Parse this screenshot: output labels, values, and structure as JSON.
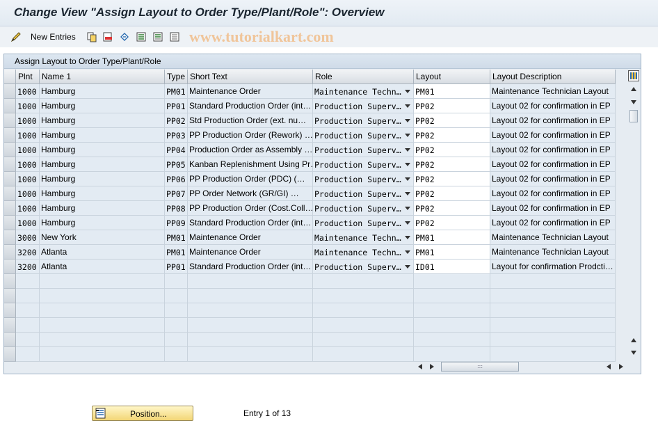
{
  "window": {
    "title": "Change View \"Assign Layout to Order Type/Plant/Role\": Overview"
  },
  "toolbar": {
    "new_entries_label": "New Entries",
    "icons": [
      "pencil-glasses-icon",
      "copy-icon",
      "delete-icon",
      "undo-icon",
      "select-all-icon",
      "select-block-icon",
      "deselect-all-icon"
    ]
  },
  "watermark": "www.tutorialkart.com",
  "panel": {
    "title": "Assign Layout to Order Type/Plant/Role"
  },
  "table": {
    "columns": [
      "Plnt",
      "Name 1",
      "Type",
      "Short Text",
      "Role",
      "Layout",
      "Layout Description"
    ],
    "rows": [
      [
        "1000",
        "Hamburg",
        "PM01",
        "Maintenance Order",
        "Maintenance Techn…",
        "PM01",
        "Maintenance Technician Layout"
      ],
      [
        "1000",
        "Hamburg",
        "PP01",
        "Standard Production Order (int…",
        "Production Superv…",
        "PP02",
        "Layout 02 for confirmation in EP"
      ],
      [
        "1000",
        "Hamburg",
        "PP02",
        "Std Production Order (ext. nu…",
        "Production Superv…",
        "PP02",
        "Layout 02 for confirmation in EP"
      ],
      [
        "1000",
        "Hamburg",
        "PP03",
        "PP Production Order (Rework) …",
        "Production Superv…",
        "PP02",
        "Layout 02 for confirmation in EP"
      ],
      [
        "1000",
        "Hamburg",
        "PP04",
        "Production Order as Assembly …",
        "Production Superv…",
        "PP02",
        "Layout 02 for confirmation in EP"
      ],
      [
        "1000",
        "Hamburg",
        "PP05",
        "Kanban Replenishment Using Pr…",
        "Production Superv…",
        "PP02",
        "Layout 02 for confirmation in EP"
      ],
      [
        "1000",
        "Hamburg",
        "PP06",
        "PP Production Order (PDC)     (…",
        "Production Superv…",
        "PP02",
        "Layout 02 for confirmation in EP"
      ],
      [
        "1000",
        "Hamburg",
        "PP07",
        "PP Order Network      (GR/GI) …",
        "Production Superv…",
        "PP02",
        "Layout 02 for confirmation in EP"
      ],
      [
        "1000",
        "Hamburg",
        "PP08",
        "PP Production Order  (Cost.Coll…",
        "Production Superv…",
        "PP02",
        "Layout 02 for confirmation in EP"
      ],
      [
        "1000",
        "Hamburg",
        "PP09",
        "Standard Production Order (int…",
        "Production Superv…",
        "PP02",
        "Layout 02 for confirmation in EP"
      ],
      [
        "3000",
        "New York",
        "PM01",
        "Maintenance Order",
        "Maintenance Techn…",
        "PM01",
        "Maintenance Technician Layout"
      ],
      [
        "3200",
        "Atlanta",
        "PM01",
        "Maintenance Order",
        "Maintenance Techn…",
        "PM01",
        "Maintenance Technician Layout"
      ],
      [
        "3200",
        "Atlanta",
        "PP01",
        "Standard Production Order (int…",
        "Production Superv…",
        "ID01",
        "Layout for confirmation Prodcti…"
      ]
    ],
    "empty_rows": 6
  },
  "footer": {
    "position_button_label": "Position...",
    "entry_text": "Entry 1 of 13"
  }
}
